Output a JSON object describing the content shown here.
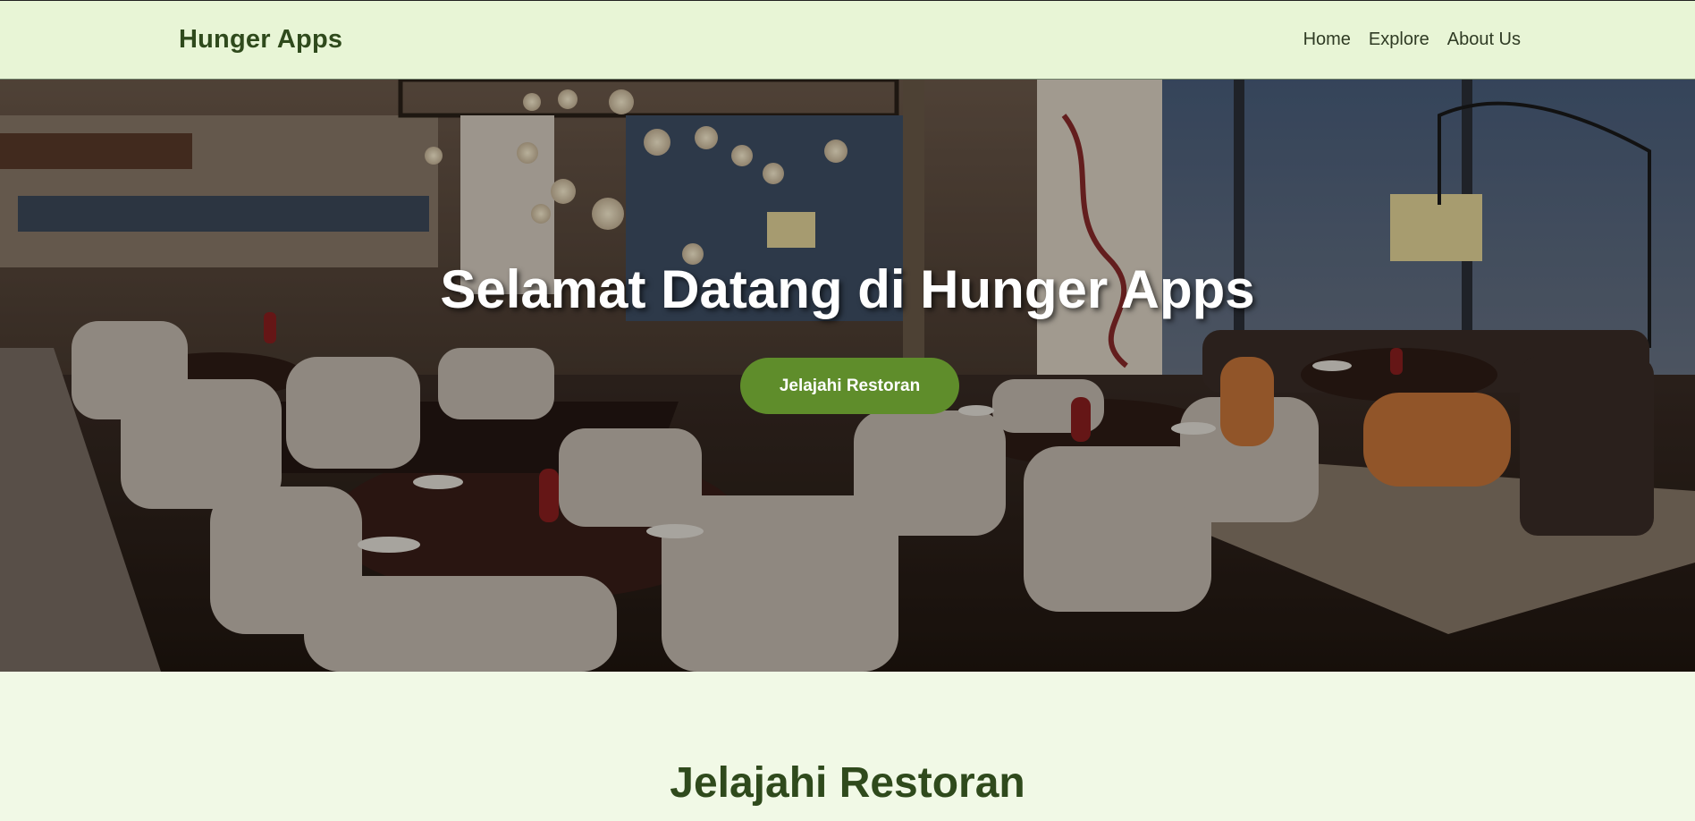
{
  "navbar": {
    "brand": "Hunger Apps",
    "links": [
      "Home",
      "Explore",
      "About Us"
    ]
  },
  "hero": {
    "title": "Selamat Datang di Hunger Apps",
    "cta_label": "Jelajahi Restoran",
    "image": "restaurant-interior-photo"
  },
  "explore": {
    "title": "Jelajahi Restoran"
  },
  "colors": {
    "navbar_bg": "#e8f5d6",
    "page_bg": "#f1f9e6",
    "brand_text": "#2f4a1c",
    "cta_bg": "#5f8d2b",
    "cta_text": "#ffffff"
  }
}
